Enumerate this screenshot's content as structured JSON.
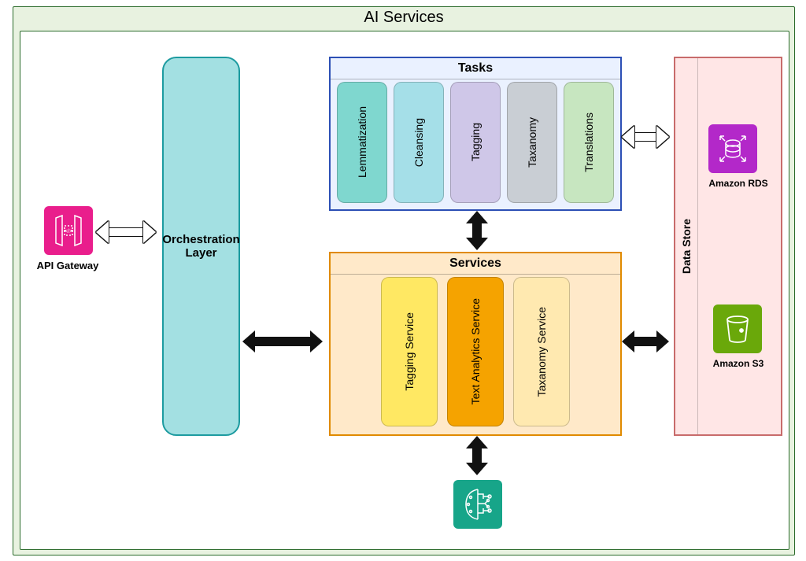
{
  "outer_title": "AI Services",
  "api_gateway": {
    "label": "API Gateway",
    "icon": "api-gateway-icon",
    "color": "#e91e8c"
  },
  "orchestration": {
    "label": "Orchestration Layer",
    "color_fill": "#a3e0e2",
    "color_border": "#1d9ba0"
  },
  "tasks": {
    "title": "Tasks",
    "items": [
      {
        "label": "Lemmatization",
        "fill": "#7fd7cf"
      },
      {
        "label": "Cleansing",
        "fill": "#a5dfe8"
      },
      {
        "label": "Tagging",
        "fill": "#cfc7e8"
      },
      {
        "label": "Taxanomy",
        "fill": "#c9ced4"
      },
      {
        "label": "Translations",
        "fill": "#c7e6c0"
      }
    ]
  },
  "services": {
    "title": "Services",
    "items": [
      {
        "label": "Tagging Service",
        "fill": "#ffe863"
      },
      {
        "label": "Text Analytics Service",
        "fill": "#f5a300"
      },
      {
        "label": "Taxanomy Service",
        "fill": "#ffe9b0"
      }
    ]
  },
  "data_store": {
    "title": "Data Store",
    "items": [
      {
        "label": "Amazon RDS",
        "icon": "rds-icon",
        "color": "#b328c9"
      },
      {
        "label": "Amazon S3",
        "icon": "s3-icon",
        "color": "#6aa80a"
      }
    ]
  },
  "sagemaker": {
    "icon": "sagemaker-icon",
    "color": "#17a589"
  }
}
